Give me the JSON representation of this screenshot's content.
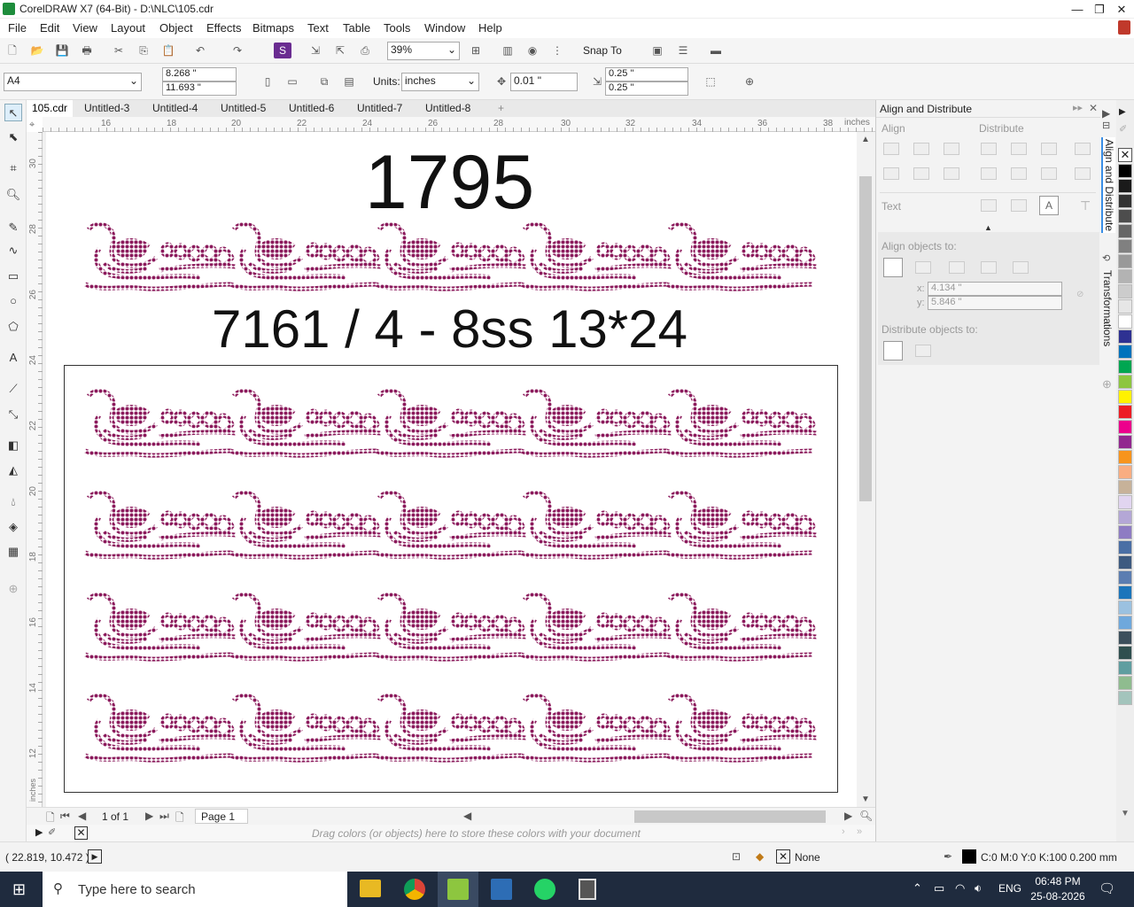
{
  "window": {
    "title": "CorelDRAW X7 (64-Bit) - D:\\NLC\\105.cdr",
    "min": "—",
    "max": "❐",
    "close": "✕"
  },
  "menu": [
    "File",
    "Edit",
    "View",
    "Layout",
    "Object",
    "Effects",
    "Bitmaps",
    "Text",
    "Table",
    "Tools",
    "Window",
    "Help"
  ],
  "toolbar": {
    "zoom": "39%",
    "snap_to": "Snap To"
  },
  "propbar": {
    "page_size": "A4",
    "width": "8.268 \"",
    "height": "11.693 \"",
    "units_label": "Units:",
    "units": "inches",
    "nudge": "0.01 \"",
    "dup_x": "0.25 \"",
    "dup_y": "0.25 \""
  },
  "tabs": [
    "105.cdr",
    "Untitled-3",
    "Untitled-4",
    "Untitled-5",
    "Untitled-6",
    "Untitled-7",
    "Untitled-8"
  ],
  "ruler": {
    "h_ticks": [
      "16",
      "18",
      "20",
      "22",
      "24",
      "26",
      "28",
      "30",
      "32",
      "34",
      "36",
      "38"
    ],
    "h_unit": "inches",
    "v_ticks": [
      "30",
      "28",
      "26",
      "24",
      "22",
      "20",
      "18",
      "16",
      "14",
      "12"
    ],
    "v_unit": "inches"
  },
  "canvas": {
    "top_text": "1795",
    "mid_text": "7161 / 4 - 8ss 13*24",
    "motif_color": "#8b1a5c"
  },
  "pagebar": {
    "page_count": "1 of 1",
    "page_tab": "Page 1"
  },
  "palette_hint": "Drag colors (or objects) here to store these colors with your document",
  "docker": {
    "title": "Align and Distribute",
    "align_label": "Align",
    "distribute_label": "Distribute",
    "text_label": "Text",
    "align_objects_to": "Align objects to:",
    "x_label": "x:",
    "x_value": "4.134 \"",
    "y_label": "y:",
    "y_value": "5.846 \"",
    "distribute_objects_to": "Distribute objects to:"
  },
  "docker_tabs": [
    "Align and Distribute",
    "Transformations"
  ],
  "palette_colors": [
    "#000000",
    "#1a1a1a",
    "#333333",
    "#4d4d4d",
    "#666666",
    "#808080",
    "#999999",
    "#b3b3b3",
    "#cccccc",
    "#e6e6e6",
    "#ffffff",
    "#2e3192",
    "#0072bc",
    "#00a651",
    "#8dc63f",
    "#fff200",
    "#ed1c24",
    "#ec008c",
    "#92278f",
    "#f7941d",
    "#f9ad81",
    "#c7b299",
    "#e1d5f0",
    "#b4a7d6",
    "#8e7cc3",
    "#4a6fa5",
    "#3d5a80",
    "#5b7db1",
    "#1b75bb",
    "#9bc1e0",
    "#6fa8dc",
    "#3c4f5c",
    "#2f4f4f",
    "#5f9ea0",
    "#8fbc8f",
    "#a3c4bc"
  ],
  "status": {
    "coords": "( 22.819, 10.472 )",
    "fill": "None",
    "outline": "C:0 M:0 Y:0 K:100  0.200 mm"
  },
  "taskbar": {
    "search_placeholder": "Type here to search",
    "lang": "ENG",
    "time": "06:48 PM",
    "date": "25-08-2026"
  }
}
